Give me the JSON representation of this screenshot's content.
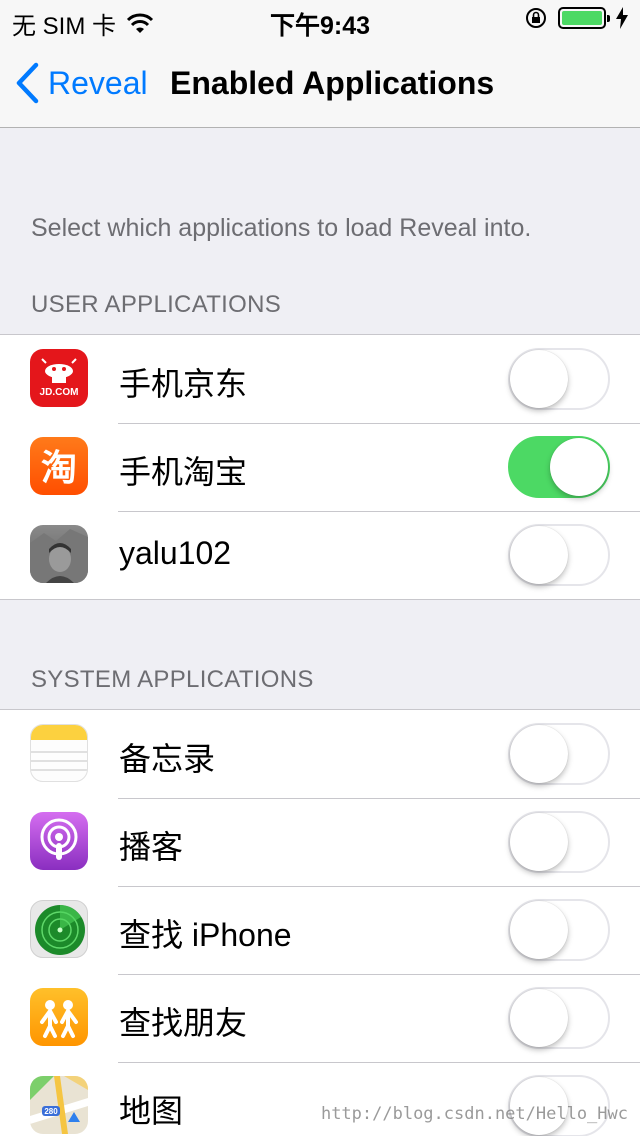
{
  "status_bar": {
    "carrier": "无 SIM 卡",
    "time": "下午9:43"
  },
  "nav": {
    "back_label": "Reveal",
    "title": "Enabled Applications"
  },
  "description": "Select which applications to load Reveal into.",
  "sections": {
    "user": {
      "header": "USER APPLICATIONS",
      "apps": [
        {
          "name": "手机京东",
          "enabled": false,
          "icon": "jd-app-icon",
          "icon_text": "JD.COM"
        },
        {
          "name": "手机淘宝",
          "enabled": true,
          "icon": "taobao-app-icon",
          "icon_text": "淘"
        },
        {
          "name": "yalu102",
          "enabled": false,
          "icon": "yalu-app-icon"
        }
      ]
    },
    "system": {
      "header": "SYSTEM APPLICATIONS",
      "apps": [
        {
          "name": "备忘录",
          "enabled": false,
          "icon": "notes-app-icon"
        },
        {
          "name": "播客",
          "enabled": false,
          "icon": "podcasts-app-icon"
        },
        {
          "name": "查找 iPhone",
          "enabled": false,
          "icon": "find-iphone-app-icon"
        },
        {
          "name": "查找朋友",
          "enabled": false,
          "icon": "find-friends-app-icon"
        },
        {
          "name": "地图",
          "enabled": false,
          "icon": "maps-app-icon",
          "icon_text": "280"
        }
      ]
    }
  },
  "watermark": "http://blog.csdn.net/Hello_Hwc",
  "colors": {
    "ios_blue": "#007aff",
    "toggle_on": "#4cd964",
    "grouped_background": "#efeff4"
  }
}
